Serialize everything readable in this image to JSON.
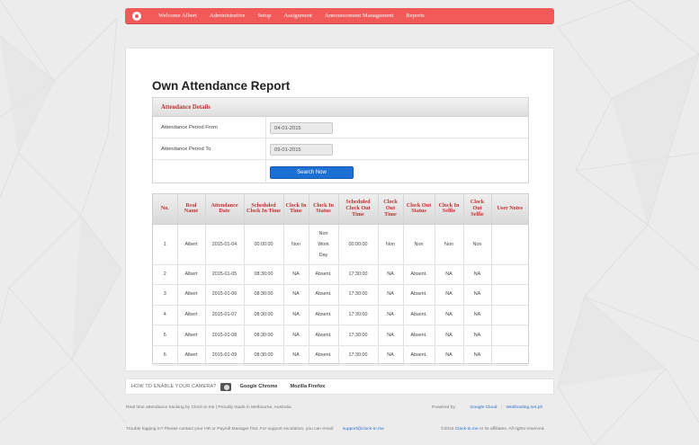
{
  "nav": {
    "items": [
      "Welcome Albert",
      "Administrative",
      "Setup",
      "Assignment",
      "Announcement Management",
      "Reports"
    ]
  },
  "page": {
    "title": "Own Attendance Report"
  },
  "details": {
    "header": "Attendance Details",
    "from_label": "Attendance Period From",
    "from_value": "04-01-2015",
    "to_label": "Attendance Period To",
    "to_value": "09-01-2015",
    "search_label": "Search Now"
  },
  "report": {
    "columns": [
      "No.",
      "Real Name",
      "Attendance Date",
      "Scheduled Clock In Time",
      "Clock In Time",
      "Clock In Status",
      "Scheduled Clock Out Time",
      "Clock Out Time",
      "Clock Out Status",
      "Clock In Selfie",
      "Clock Out Selfie",
      "User Notes"
    ],
    "rows": [
      [
        "1",
        "Albert",
        "2015-01-04",
        "00:00:00",
        "Non",
        "Non Work Day",
        "00:00:00",
        "Non",
        "Non",
        "Non",
        "Non",
        ""
      ],
      [
        "2",
        "Albert",
        "2015-01-05",
        "08:30:00",
        "NA",
        "Absent.",
        "17:30:00",
        "NA",
        "Absent.",
        "NA",
        "NA",
        ""
      ],
      [
        "3",
        "Albert",
        "2015-01-06",
        "08:30:00",
        "NA",
        "Absent.",
        "17:30:00",
        "NA",
        "Absent.",
        "NA",
        "NA",
        ""
      ],
      [
        "4",
        "Albert",
        "2015-01-07",
        "08:30:00",
        "NA",
        "Absent.",
        "17:30:00",
        "NA",
        "Absent.",
        "NA",
        "NA",
        ""
      ],
      [
        "5",
        "Albert",
        "2015-01-08",
        "08:30:00",
        "NA",
        "Absent.",
        "17:30:00",
        "NA",
        "Absent.",
        "NA",
        "NA",
        ""
      ],
      [
        "6",
        "Albert",
        "2015-01-09",
        "08:30:00",
        "NA",
        "Absent.",
        "17:30:00",
        "NA",
        "Absent.",
        "NA",
        "NA",
        ""
      ]
    ]
  },
  "camera_bar": {
    "text": "HOW TO ENABLE YOUR CAMERA?",
    "chrome": "Google Chrome",
    "firefox": "Mozilla Firefox"
  },
  "footer": {
    "left1": "Real time attendance tracking by Clock-in.me  |  Proudly made in Melbourne, Australia",
    "powered_by": "Powered by:",
    "powered1": "Google Cloud",
    "powered2": "Webhosting.net.ph",
    "left2": "Trouble logging in? Please contact your HR or Payroll Manager first. For support escalation, you can email:",
    "support_email": "support@clock-in.me",
    "right2_prefix": "©2015",
    "right2_brand": "Clock-in.me",
    "right2_suffix": "or its affiliates. All rights reserved."
  },
  "colors": {
    "nav": "#f25a5a",
    "header_text": "#c03030",
    "button": "#1c6fd3",
    "link": "#2a6fc9"
  }
}
